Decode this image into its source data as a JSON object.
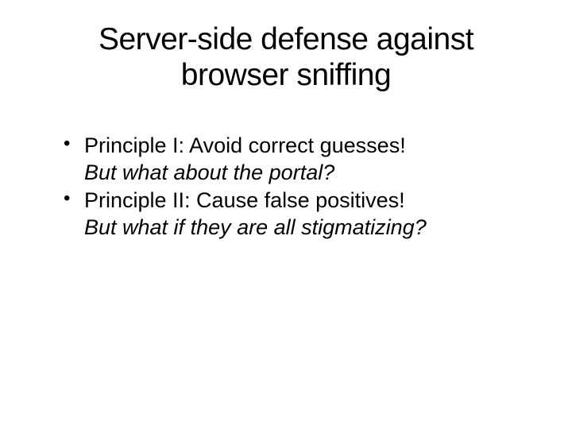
{
  "title_line1": "Server-side defense against",
  "title_line2": "browser sniffing",
  "bullets": {
    "item1": "Principle I: Avoid correct guesses!",
    "sub1": "But what about the portal?",
    "item2": "Principle II: Cause false positives!",
    "sub2": "But what if they are all stigmatizing?"
  }
}
